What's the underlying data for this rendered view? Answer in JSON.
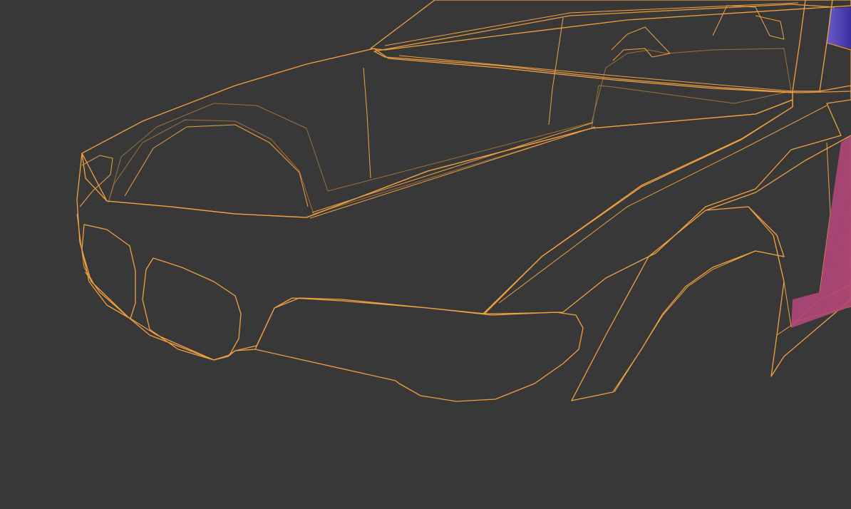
{
  "viewport": {
    "background": "#383838",
    "selection_outline_color": "#f0a040",
    "shading": "normal-map-gradient",
    "colors": {
      "teal_green": "#4ab08e",
      "light_teal": "#5fc0a8",
      "mint": "#66c4ab",
      "blue_violet": "#4b3fb0",
      "slate_blue": "#5a78a8",
      "magenta": "#b2457e",
      "purple": "#8a4aa6",
      "grey_violet": "#8a8aa8"
    }
  }
}
